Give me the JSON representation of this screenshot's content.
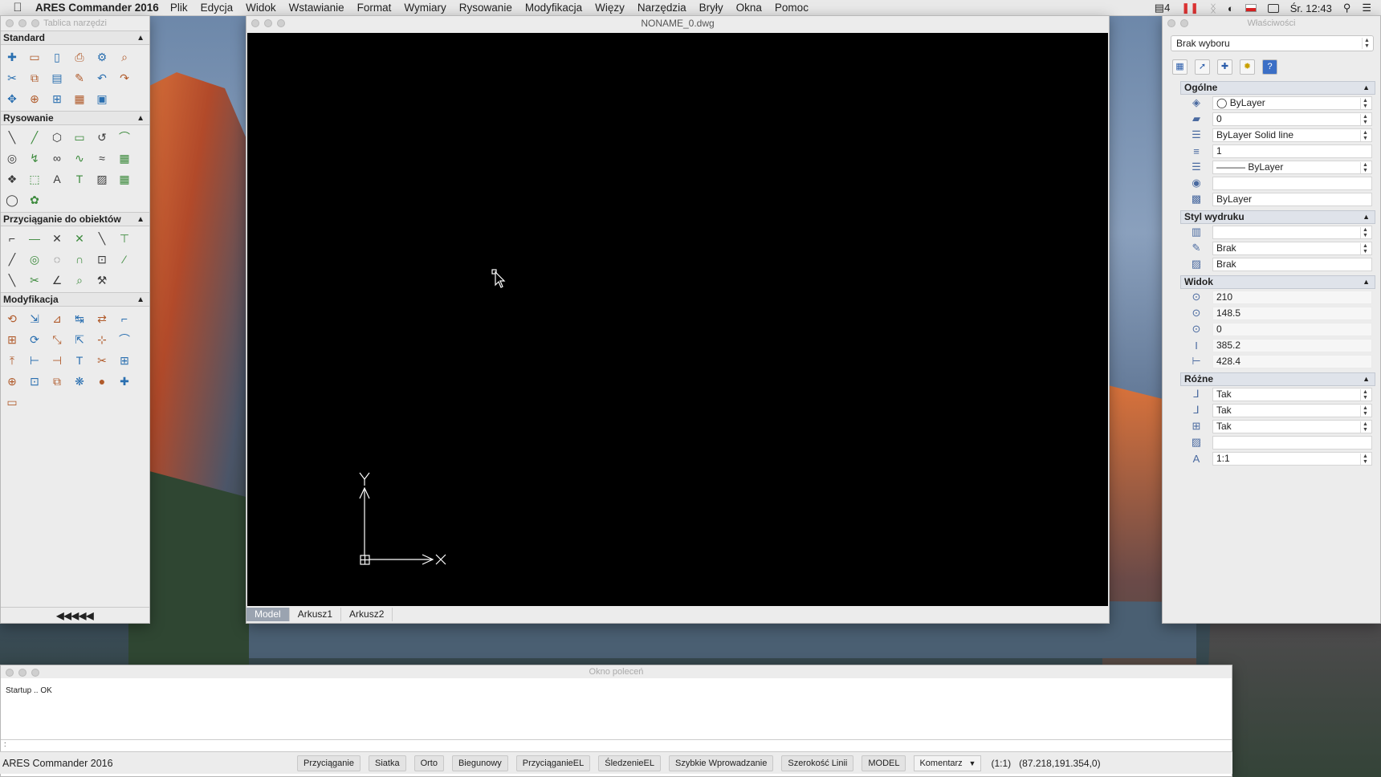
{
  "menubar": {
    "app": "ARES Commander 2016",
    "items": [
      "Plik",
      "Edycja",
      "Widok",
      "Wstawianie",
      "Format",
      "Wymiary",
      "Rysowanie",
      "Modyfikacja",
      "Więzy",
      "Narzędzia",
      "Bryły",
      "Okna",
      "Pomoc"
    ],
    "notif_count": "4",
    "clock": "Śr. 12:43"
  },
  "toolbox": {
    "title": "Tablica narzędzi",
    "sections": [
      {
        "title": "Standard",
        "tools": [
          "new-icon",
          "open-icon",
          "save-icon",
          "print-icon",
          "print-setup-icon",
          "preview-icon",
          "cut-icon",
          "copy-icon",
          "paste-icon",
          "match-props-icon",
          "undo-icon",
          "redo-icon",
          "pan-icon",
          "zoom-icon",
          "zoom-window-icon",
          "layers-icon",
          "calc-icon"
        ]
      },
      {
        "title": "Rysowanie",
        "tools": [
          "line-icon",
          "ray-icon",
          "polygon-icon",
          "rectangle-icon",
          "arc-icon",
          "polyline-icon",
          "circle-icon",
          "spline-icon",
          "cloud-icon",
          "point-icon",
          "curve-icon",
          "hatch-icon",
          "block-icon",
          "region-icon",
          "text-icon",
          "mtext-icon",
          "image-icon",
          "table-icon",
          "ellipse-icon",
          "gear-icon"
        ]
      },
      {
        "title": "Przyciąganie do obiektów",
        "tools": [
          "snap-end-icon",
          "snap-mid-icon",
          "snap-int-icon",
          "snap-app-int-icon",
          "snap-ext-icon",
          "snap-perp-icon",
          "snap-near-icon",
          "snap-center-icon",
          "snap-quad-icon",
          "snap-tan-icon",
          "snap-insert-icon",
          "snap-node-icon",
          "snap-parallel-icon",
          "snap-clear-icon",
          "snap-angle-icon",
          "snap-track-icon",
          "snap-settings-icon"
        ]
      },
      {
        "title": "Modyfikacja",
        "tools": [
          "erase-icon",
          "copy-obj-icon",
          "move-icon",
          "mirror-icon",
          "offset-icon",
          "chamfer-icon",
          "array-icon",
          "rotate-icon",
          "scale-icon",
          "stretch-icon",
          "align-icon",
          "fillet-icon",
          "extend-icon",
          "break-icon",
          "join-icon",
          "lengthen-icon",
          "trim-icon",
          "explode-icon",
          "edit-icon",
          "cross-icon",
          "hatch-edit-icon",
          "group-icon",
          "tree-icon",
          "sort-icon",
          "bomb-icon"
        ]
      }
    ],
    "collapse_label": "◀◀◀◀◀"
  },
  "drawing": {
    "title": "NONAME_0.dwg",
    "ucs_x": "X",
    "ucs_y": "Y",
    "tabs": [
      "Model",
      "Arkusz1",
      "Arkusz2"
    ],
    "active_tab": 0
  },
  "properties": {
    "title": "Właściwości",
    "selection": "Brak wyboru",
    "sections": [
      {
        "title": "Ogólne",
        "rows": [
          {
            "icon": "color-icon",
            "value": "◯ ByLayer",
            "dropdown": true
          },
          {
            "icon": "layer-icon",
            "value": "0",
            "dropdown": true
          },
          {
            "icon": "linetype-icon",
            "value": "ByLayer     Solid line",
            "dropdown": true
          },
          {
            "icon": "ltscale-icon",
            "value": "1",
            "dropdown": false
          },
          {
            "icon": "lineweight-icon",
            "value": "——— ByLayer",
            "dropdown": true
          },
          {
            "icon": "hyperlink-icon",
            "value": "",
            "dropdown": false
          },
          {
            "icon": "transparency-icon",
            "value": "ByLayer",
            "dropdown": false
          }
        ]
      },
      {
        "title": "Styl wydruku",
        "rows": [
          {
            "icon": "plotstyle-icon",
            "value": "",
            "dropdown": true
          },
          {
            "icon": "plotstyle-table-icon",
            "value": "Brak",
            "dropdown": true
          },
          {
            "icon": "plotstyle-attached-icon",
            "value": "Brak",
            "dropdown": false
          }
        ]
      },
      {
        "title": "Widok",
        "rows": [
          {
            "icon": "center-x-icon",
            "value": "210",
            "dropdown": false
          },
          {
            "icon": "center-y-icon",
            "value": "148.5",
            "dropdown": false
          },
          {
            "icon": "center-z-icon",
            "value": "0",
            "dropdown": false
          },
          {
            "icon": "height-icon",
            "value": "385.2",
            "dropdown": false
          },
          {
            "icon": "width-icon",
            "value": "428.4",
            "dropdown": false
          }
        ]
      },
      {
        "title": "Różne",
        "rows": [
          {
            "icon": "ucs-on-icon",
            "value": "Tak",
            "dropdown": true
          },
          {
            "icon": "ucs-origin-icon",
            "value": "Tak",
            "dropdown": true
          },
          {
            "icon": "ucs-viewport-icon",
            "value": "Tak",
            "dropdown": true
          },
          {
            "icon": "ucs-name-icon",
            "value": "",
            "dropdown": false
          },
          {
            "icon": "annotation-scale-icon",
            "value": "1:1",
            "dropdown": true
          }
        ]
      }
    ]
  },
  "command": {
    "title": "Okno poleceń",
    "history": "Startup .. OK",
    "prompt": ":"
  },
  "status": {
    "app": "ARES Commander 2016",
    "buttons": [
      "Przyciąganie",
      "Siatka",
      "Orto",
      "Biegunowy",
      "PrzyciąganieEL",
      "ŚledzenieEL",
      "Szybkie Wprowadzanie",
      "Szerokość Linii",
      "MODEL"
    ],
    "annotation_dropdown": "Komentarz",
    "scale": "(1:1)",
    "coords": "(87.218,191.354,0)"
  }
}
